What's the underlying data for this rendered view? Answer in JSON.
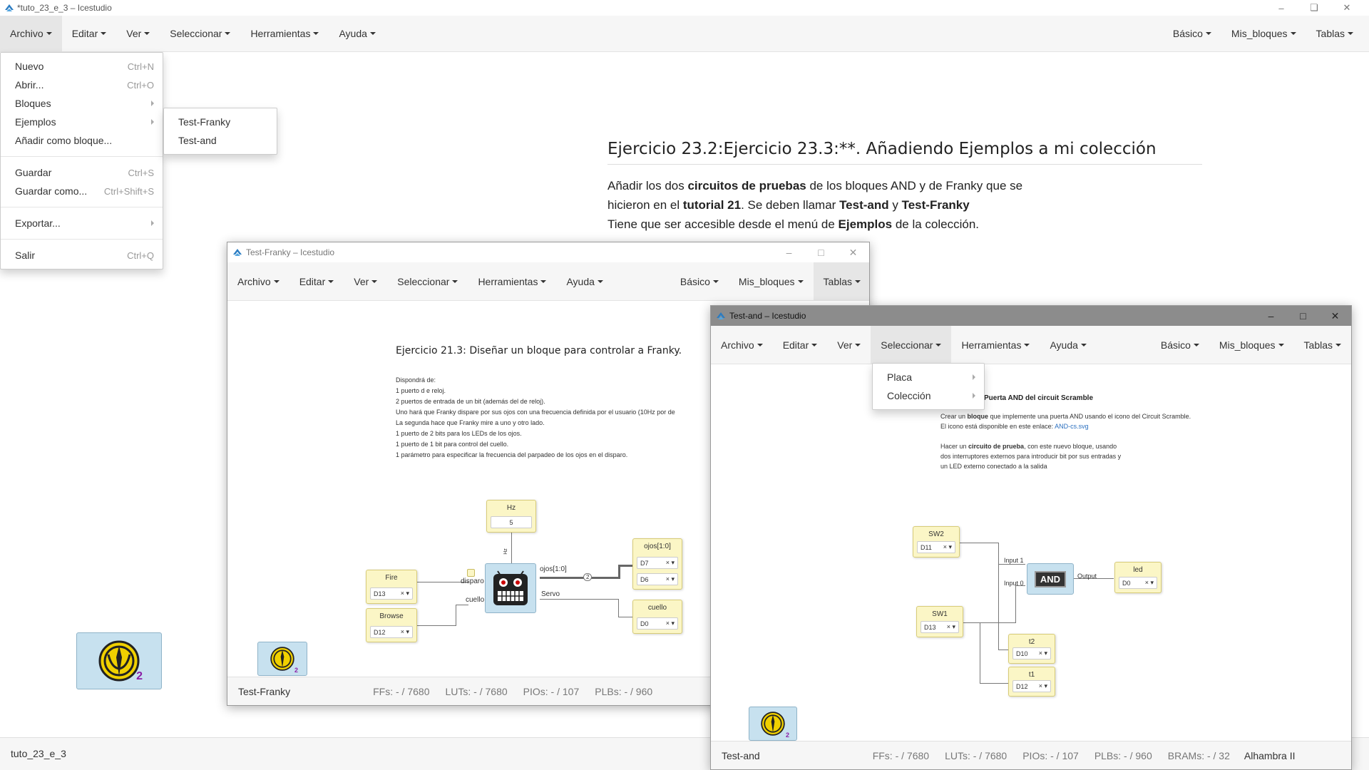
{
  "window": {
    "title": "*tuto_23_e_3 – Icestudio"
  },
  "menubar": {
    "left": [
      "Archivo",
      "Editar",
      "Ver",
      "Seleccionar",
      "Herramientas",
      "Ayuda"
    ],
    "right": [
      "Básico",
      "Mis_bloques",
      "Tablas"
    ]
  },
  "archivo_menu": {
    "nuevo": {
      "label": "Nuevo",
      "shortcut": "Ctrl+N"
    },
    "abrir": {
      "label": "Abrir...",
      "shortcut": "Ctrl+O"
    },
    "bloques": "Bloques",
    "ejemplos": "Ejemplos",
    "anadir": "Añadir como bloque...",
    "guardar": {
      "label": "Guardar",
      "shortcut": "Ctrl+S"
    },
    "guardar_como": {
      "label": "Guardar como...",
      "shortcut": "Ctrl+Shift+S"
    },
    "exportar": "Exportar...",
    "salir": {
      "label": "Salir",
      "shortcut": "Ctrl+Q"
    }
  },
  "ejemplos_submenu": [
    "Test-Franky",
    "Test-and"
  ],
  "doc": {
    "heading": "Ejercicio 23.2:Ejercicio 23.3:**. Añadiendo Ejemplos a mi colección",
    "p1a": "Añadir los dos ",
    "p1b": "circuitos de pruebas",
    "p1c": " de los bloques AND y de Franky que se",
    "p2a": "hicieron en el ",
    "p2b": "tutorial 21",
    "p2c": ". Se deben llamar ",
    "p2d": "Test-and",
    "p2e": " y ",
    "p2f": "Test-Franky",
    "p3a": "Tiene que ser accesible desde el menú de ",
    "p3b": "Ejemplos",
    "p3c": " de la colección."
  },
  "main_status": {
    "filename": "tuto_23_e_3"
  },
  "main_badge": {
    "number": "2"
  },
  "franky_window": {
    "title": "Test-Franky – Icestudio",
    "menubar": {
      "left": [
        "Archivo",
        "Editar",
        "Ver",
        "Seleccionar",
        "Herramientas",
        "Ayuda"
      ],
      "right": [
        "Básico",
        "Mis_bloques",
        "Tablas"
      ]
    },
    "heading": "Ejercicio 21.3: Diseñar un bloque para controlar a Franky.",
    "desc": [
      "Dispondrá de:",
      "1 puerto d e reloj.",
      "2 puertos de entrada de un bit (además del de reloj).",
      "Uno hará que Franky dispare por sus ojos con una frecuencia definida por el usuario (10Hz por de",
      "La segunda hace que Franky mire a uno y otro lado.",
      "1 puerto de 2 bits para los LEDs de los ojos.",
      "1 puerto de 1 bit para control del cuello.",
      "1 parámetro para especificar la frecuencia del parpadeo de los ojos en el disparo."
    ],
    "blocks": {
      "hz": {
        "name": "Hz",
        "value": "5"
      },
      "fire": {
        "name": "Fire",
        "pin": "D13"
      },
      "browse": {
        "name": "Browse",
        "pin": "D12"
      },
      "ojos": {
        "name": "ojos[1:0]",
        "pin1": "D7",
        "pin2": "D6"
      },
      "cuello": {
        "name": "cuello",
        "pin": "D0"
      }
    },
    "labels": {
      "disparo": "disparo",
      "cuello": "cuello",
      "ojos_out": "ojos[1:0]",
      "servo": "Servo",
      "bus": "2",
      "hz_port": "Hz"
    },
    "status": {
      "name": "Test-Franky",
      "ffs": "FFs:  - / 7680",
      "luts": "LUTs:  - / 7680",
      "pios": "PIOs:  - / 107",
      "plbs": "PLBs:  - / 960"
    },
    "badge_number": "2"
  },
  "and_window": {
    "title": "Test-and – Icestudio",
    "menubar": {
      "left": [
        "Archivo",
        "Editar",
        "Ver",
        "Seleccionar",
        "Herramientas",
        "Ayuda"
      ],
      "right": [
        "Básico",
        "Mis_bloques",
        "Tablas"
      ]
    },
    "seleccionar_menu": [
      "Placa",
      "Colección"
    ],
    "heading_partial": "Puerta AND del circuit Scramble",
    "desc1a": "Crear un ",
    "desc1b": "bloque",
    "desc1c": " que implemente una puerta AND usando el icono del Circuit Scramble.",
    "desc2a": "El icono está disponible en este enlace: ",
    "desc2b": "AND-cs.svg",
    "desc3a": "Hacer un ",
    "desc3b": "circuito de prueba",
    "desc3c": ", con este nuevo bloque, usando",
    "desc4": "dos interruptores externos para introducir bit por sus entradas y",
    "desc5": "un LED externo conectado a la salida",
    "blocks": {
      "sw2": {
        "name": "SW2",
        "pin": "D11"
      },
      "sw1": {
        "name": "SW1",
        "pin": "D13"
      },
      "led": {
        "name": "led",
        "pin": "D0"
      },
      "t2": {
        "name": "t2",
        "pin": "D10"
      },
      "t1": {
        "name": "t1",
        "pin": "D12"
      },
      "and_label": "AND",
      "in1": "Input 1",
      "in0": "Input 0",
      "out": "Output"
    },
    "status": {
      "name": "Test-and",
      "ffs": "FFs:  - / 7680",
      "luts": "LUTs:  - / 7680",
      "pios": "PIOs:  - / 107",
      "plbs": "PLBs:  - / 960",
      "brams": "BRAMs:  - / 32",
      "board": "Alhambra II"
    },
    "badge_number": "2"
  }
}
